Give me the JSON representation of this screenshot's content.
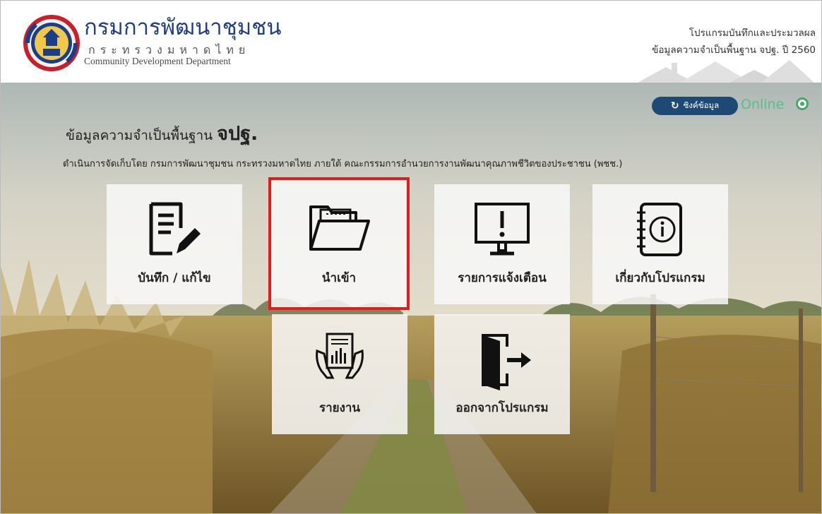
{
  "header": {
    "org_name_th": "กรมการพัฒนาชุมชน",
    "org_ministry_th": "กระทรวงมหาดไทย",
    "org_name_en": "Community Development Department",
    "app_title_line1": "โปรแกรมบันทึกและประมวลผล",
    "app_title_line2": "ข้อมูลความจำเป็นพื้นฐาน จปฐ. ปี 2560"
  },
  "status": {
    "sync_label": "ซิงค์ข้อมูล",
    "online_label": "Online",
    "online_color": "#46a86f"
  },
  "main": {
    "title_prefix": "ข้อมูลความจำเป็นพื้นฐาน",
    "title_emphasis": "จปฐ.",
    "subtitle": "ดำเนินการจัดเก็บโดย กรมการพัฒนาชุมชน กระทรวงมหาดไทย ภายใต้ คณะกรรมการอำนวยการงานพัฒนาคุณภาพชีวิตของประชาชน (พชช.)"
  },
  "tiles": [
    {
      "label": "บันทึก / แก้ไข",
      "icon": "document-edit-icon"
    },
    {
      "label": "นำเข้า",
      "icon": "open-folder-icon",
      "highlighted": true
    },
    {
      "label": "รายการแจ้งเตือน",
      "icon": "monitor-alert-icon"
    },
    {
      "label": "เกี่ยวกับโปรแกรม",
      "icon": "info-notebook-icon"
    },
    {
      "label": "รายงาน",
      "icon": "report-hands-icon"
    },
    {
      "label": "ออกจากโปรแกรม",
      "icon": "exit-door-icon"
    }
  ],
  "colors": {
    "header_text": "#1e3e86",
    "sync_button": "#1e4975",
    "highlight_border": "#e01c1c"
  }
}
